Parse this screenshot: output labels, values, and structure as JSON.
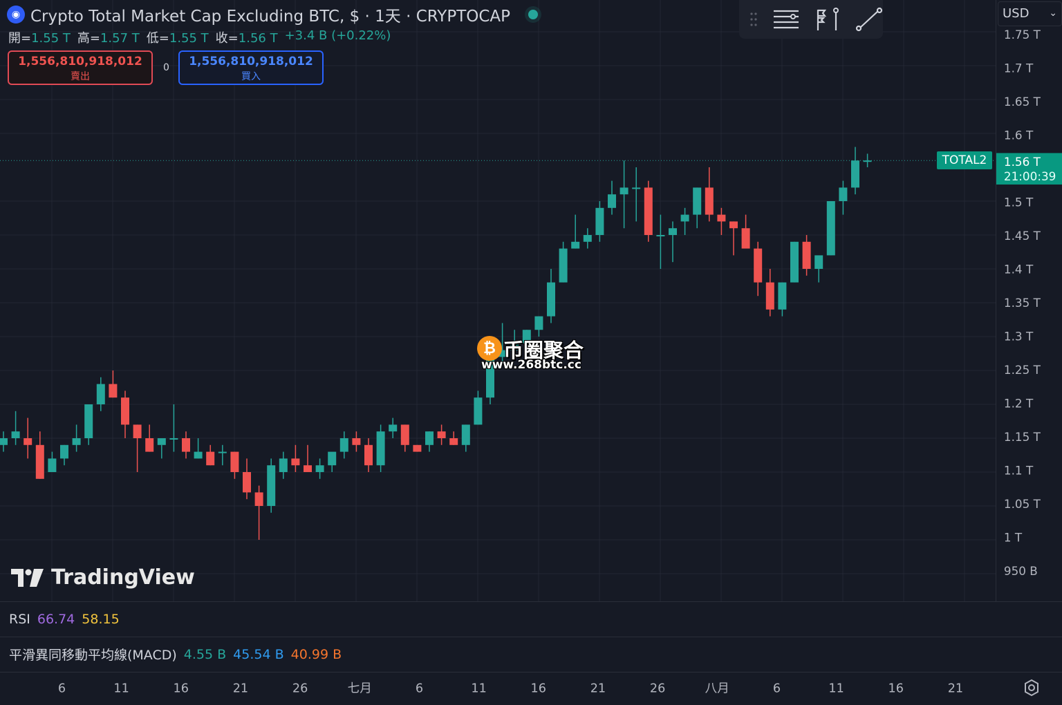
{
  "header": {
    "title": "Crypto Total Market Cap Excluding BTC, $ · 1天 · CRYPTOCAP",
    "symbol_icon": "cryptocap-logo-icon",
    "status": "live-dot"
  },
  "ohlc": {
    "open_label": "開=",
    "open": "1.55 T",
    "high_label": "高=",
    "high": "1.57 T",
    "low_label": "低=",
    "low": "1.55 T",
    "close_label": "收=",
    "close": "1.56 T",
    "change": "+3.4 B (+0.22%)"
  },
  "trade": {
    "sell_price": "1,556,810,918,012",
    "sell_label": "賣出",
    "spread": "0",
    "buy_price": "1,556,810,918,012",
    "buy_label": "買入"
  },
  "toolbar": {
    "icons": [
      "drag-handle-icon",
      "lines-menu-icon",
      "flag-pole-icon",
      "trend-line-icon"
    ]
  },
  "currency": {
    "value": "USD"
  },
  "watermark": {
    "cn": "币圈聚合",
    "url": "www.268btc.cc"
  },
  "brand": {
    "name": "TradingView"
  },
  "last_price": {
    "symbol": "TOTAL2",
    "price": "1.56 T",
    "countdown": "21:00:39"
  },
  "price_axis": {
    "labels": [
      "1.75 T",
      "1.7 T",
      "1.65 T",
      "1.6 T",
      "1.5 T",
      "1.45 T",
      "1.4 T",
      "1.35 T",
      "1.3 T",
      "1.25 T",
      "1.2 T",
      "1.15 T",
      "1.1 T",
      "1.05 T",
      "1 T",
      "950 B"
    ],
    "values": [
      1.75,
      1.7,
      1.65,
      1.6,
      1.5,
      1.45,
      1.4,
      1.35,
      1.3,
      1.25,
      1.2,
      1.15,
      1.1,
      1.05,
      1.0,
      0.95
    ]
  },
  "time_axis": {
    "labels": [
      "6",
      "11",
      "16",
      "21",
      "26",
      "七月",
      "6",
      "11",
      "16",
      "21",
      "26",
      "八月",
      "6",
      "11",
      "16",
      "21"
    ]
  },
  "indicators": {
    "rsi": {
      "label": "RSI",
      "v1": "66.74",
      "v2": "58.15"
    },
    "macd": {
      "label": "平滑異同移動平均線(MACD)",
      "v1": "4.55 B",
      "v2": "45.54 B",
      "v3": "40.99 B"
    }
  },
  "colors": {
    "up": "#26a69a",
    "down": "#ef5350",
    "bg": "#161a25",
    "grid": "#232733"
  },
  "chart_data": {
    "type": "candlestick",
    "x_labels": [
      "6",
      "11",
      "16",
      "21",
      "26",
      "七月",
      "6",
      "11",
      "16",
      "21",
      "26",
      "八月",
      "6",
      "11",
      "16",
      "21"
    ],
    "y_unit": "T",
    "ylim": [
      0.95,
      1.75
    ],
    "candles": [
      [
        1.14,
        1.16,
        1.13,
        1.15
      ],
      [
        1.15,
        1.19,
        1.14,
        1.16
      ],
      [
        1.15,
        1.18,
        1.12,
        1.14
      ],
      [
        1.14,
        1.16,
        1.09,
        1.09
      ],
      [
        1.1,
        1.13,
        1.1,
        1.12
      ],
      [
        1.12,
        1.14,
        1.11,
        1.14
      ],
      [
        1.14,
        1.17,
        1.13,
        1.15
      ],
      [
        1.15,
        1.2,
        1.14,
        1.2
      ],
      [
        1.2,
        1.24,
        1.19,
        1.23
      ],
      [
        1.23,
        1.25,
        1.21,
        1.21
      ],
      [
        1.21,
        1.22,
        1.15,
        1.17
      ],
      [
        1.17,
        1.17,
        1.1,
        1.15
      ],
      [
        1.15,
        1.17,
        1.13,
        1.13
      ],
      [
        1.14,
        1.14,
        1.12,
        1.15
      ],
      [
        1.15,
        1.2,
        1.13,
        1.15
      ],
      [
        1.15,
        1.16,
        1.12,
        1.13
      ],
      [
        1.12,
        1.15,
        1.12,
        1.13
      ],
      [
        1.13,
        1.14,
        1.11,
        1.11
      ],
      [
        1.13,
        1.14,
        1.11,
        1.13
      ],
      [
        1.13,
        1.13,
        1.09,
        1.1
      ],
      [
        1.1,
        1.12,
        1.06,
        1.07
      ],
      [
        1.07,
        1.08,
        1.0,
        1.05
      ],
      [
        1.05,
        1.12,
        1.04,
        1.11
      ],
      [
        1.1,
        1.13,
        1.09,
        1.12
      ],
      [
        1.12,
        1.14,
        1.1,
        1.11
      ],
      [
        1.11,
        1.14,
        1.1,
        1.1
      ],
      [
        1.1,
        1.12,
        1.09,
        1.11
      ],
      [
        1.11,
        1.12,
        1.1,
        1.13
      ],
      [
        1.13,
        1.16,
        1.12,
        1.15
      ],
      [
        1.15,
        1.16,
        1.13,
        1.14
      ],
      [
        1.14,
        1.15,
        1.1,
        1.11
      ],
      [
        1.11,
        1.17,
        1.1,
        1.16
      ],
      [
        1.16,
        1.18,
        1.15,
        1.17
      ],
      [
        1.17,
        1.17,
        1.13,
        1.14
      ],
      [
        1.14,
        1.14,
        1.13,
        1.13
      ],
      [
        1.14,
        1.16,
        1.13,
        1.16
      ],
      [
        1.16,
        1.17,
        1.14,
        1.15
      ],
      [
        1.15,
        1.16,
        1.14,
        1.14
      ],
      [
        1.14,
        1.17,
        1.13,
        1.17
      ],
      [
        1.17,
        1.22,
        1.17,
        1.21
      ],
      [
        1.21,
        1.27,
        1.2,
        1.27
      ],
      [
        1.27,
        1.32,
        1.26,
        1.28
      ],
      [
        1.28,
        1.31,
        1.27,
        1.29
      ],
      [
        1.29,
        1.31,
        1.28,
        1.31
      ],
      [
        1.31,
        1.33,
        1.3,
        1.33
      ],
      [
        1.33,
        1.4,
        1.32,
        1.38
      ],
      [
        1.38,
        1.44,
        1.38,
        1.43
      ],
      [
        1.43,
        1.48,
        1.43,
        1.44
      ],
      [
        1.44,
        1.46,
        1.43,
        1.45
      ],
      [
        1.45,
        1.5,
        1.44,
        1.49
      ],
      [
        1.49,
        1.53,
        1.48,
        1.51
      ],
      [
        1.51,
        1.56,
        1.46,
        1.52
      ],
      [
        1.52,
        1.55,
        1.47,
        1.52
      ],
      [
        1.52,
        1.53,
        1.44,
        1.45
      ],
      [
        1.45,
        1.48,
        1.4,
        1.45
      ],
      [
        1.45,
        1.47,
        1.41,
        1.46
      ],
      [
        1.47,
        1.49,
        1.45,
        1.48
      ],
      [
        1.48,
        1.52,
        1.46,
        1.52
      ],
      [
        1.52,
        1.55,
        1.47,
        1.48
      ],
      [
        1.48,
        1.49,
        1.45,
        1.47
      ],
      [
        1.47,
        1.47,
        1.42,
        1.46
      ],
      [
        1.46,
        1.48,
        1.44,
        1.43
      ],
      [
        1.43,
        1.44,
        1.36,
        1.38
      ],
      [
        1.38,
        1.4,
        1.33,
        1.34
      ],
      [
        1.34,
        1.38,
        1.33,
        1.38
      ],
      [
        1.38,
        1.44,
        1.38,
        1.44
      ],
      [
        1.44,
        1.45,
        1.39,
        1.4
      ],
      [
        1.4,
        1.41,
        1.38,
        1.42
      ],
      [
        1.42,
        1.5,
        1.42,
        1.5
      ],
      [
        1.5,
        1.53,
        1.48,
        1.52
      ],
      [
        1.52,
        1.58,
        1.51,
        1.56
      ],
      [
        1.56,
        1.57,
        1.55,
        1.56
      ]
    ]
  }
}
